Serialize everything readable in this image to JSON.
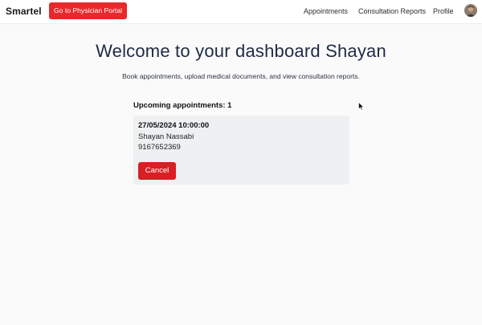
{
  "navbar": {
    "brand": "Smartel",
    "portal_button": "Go to Physician Portal",
    "links": {
      "appointments": "Appointments",
      "consultation_reports": "Consultation Reports",
      "profile": "Profile"
    }
  },
  "main": {
    "title": "Welcome to your dashboard Shayan",
    "subtitle": "Book appointments, upload medical documents, and view consultation reports.",
    "upcoming_heading": "Upcoming appointments: 1",
    "appointments": [
      {
        "datetime": "27/05/2024 10:00:00",
        "name": "Shayan Nassabi",
        "phone": "9167652369",
        "cancel_label": "Cancel"
      }
    ]
  },
  "colors": {
    "primary_red": "#e8282b",
    "cancel_red": "#d71f24",
    "title_navy": "#1e2a44",
    "card_bg": "#eef0f2"
  },
  "icons": {
    "avatar": "user-avatar-photo",
    "cursor": "mouse-pointer-icon"
  }
}
